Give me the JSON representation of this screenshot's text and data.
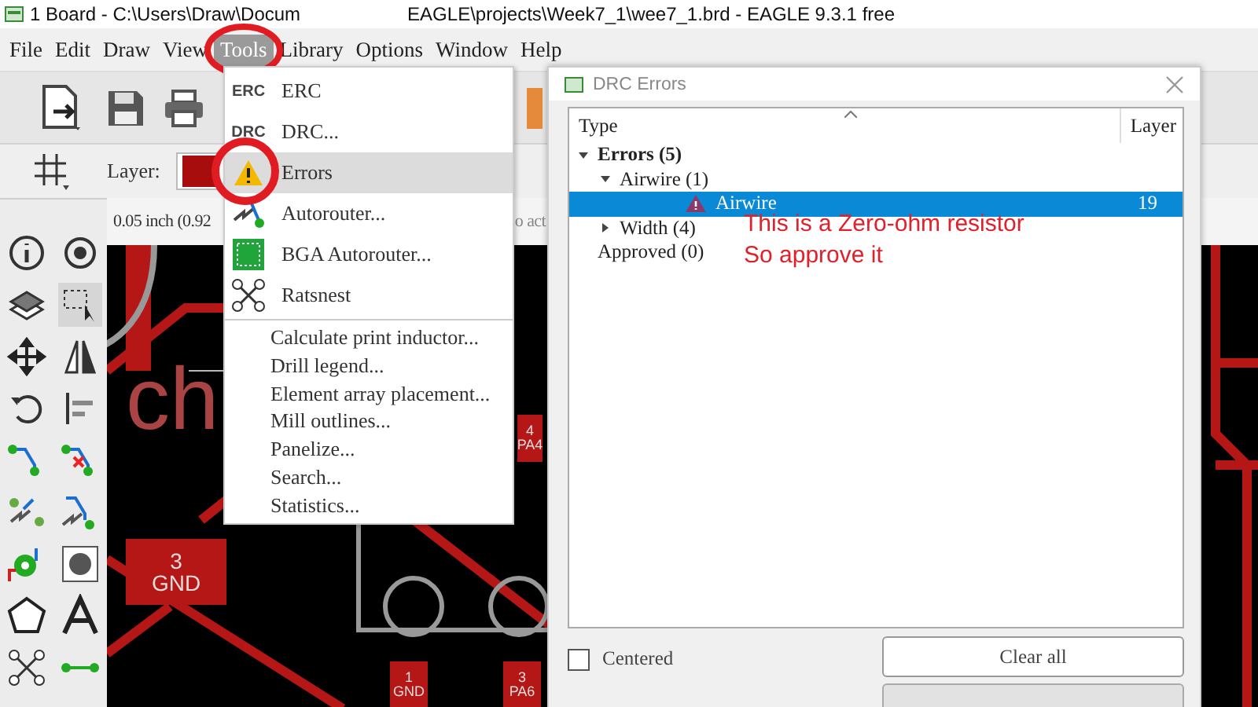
{
  "window": {
    "title_start": "1 Board - C:\\Users\\Draw\\Docum",
    "title_end": "EAGLE\\projects\\Week7_1\\wee7_1.brd - EAGLE 9.3.1 free"
  },
  "menu_bar": [
    {
      "label": "File",
      "selected": false
    },
    {
      "label": "Edit",
      "selected": false
    },
    {
      "label": "Draw",
      "selected": false
    },
    {
      "label": "View",
      "selected": false
    },
    {
      "label": "Tools",
      "selected": true
    },
    {
      "label": "Library",
      "selected": false
    },
    {
      "label": "Options",
      "selected": false
    },
    {
      "label": "Window",
      "selected": false
    },
    {
      "label": "Help",
      "selected": false
    }
  ],
  "layer_bar": {
    "label": "Layer:",
    "color": "#a80d0d"
  },
  "status": {
    "coordinates": "0.05 inch (0.92",
    "message_fragment": "o act"
  },
  "tools_menu": {
    "items": [
      {
        "kind": "erc",
        "icon_label": "ERC",
        "label": "ERC",
        "selected": false
      },
      {
        "kind": "drc",
        "icon_label": "DRC",
        "label": "DRC...",
        "selected": false
      },
      {
        "kind": "warning",
        "label": "Errors",
        "selected": true
      },
      {
        "kind": "autorouter",
        "label": "Autorouter...",
        "selected": false
      },
      {
        "kind": "bga",
        "label": "BGA Autorouter...",
        "selected": false
      },
      {
        "kind": "ratsnest",
        "label": "Ratsnest",
        "selected": false
      },
      {
        "kind": "separator"
      },
      {
        "kind": "plain",
        "label": "Calculate print inductor...",
        "selected": false
      },
      {
        "kind": "plain",
        "label": "Drill legend...",
        "selected": false
      },
      {
        "kind": "plain",
        "label": "Element array placement...",
        "selected": false
      },
      {
        "kind": "plain",
        "label": "Mill outlines...",
        "selected": false
      },
      {
        "kind": "plain",
        "label": "Panelize...",
        "selected": false
      },
      {
        "kind": "plain",
        "label": "Search...",
        "selected": false
      },
      {
        "kind": "plain",
        "label": "Statistics...",
        "selected": false
      }
    ]
  },
  "pcb": {
    "silkscreen_text": "ch",
    "pads": [
      {
        "number": "3",
        "net": "GND"
      },
      {
        "number": "4",
        "net": "PA4"
      },
      {
        "number": "1",
        "net": "GND"
      },
      {
        "number": "3",
        "net": "PA6"
      }
    ]
  },
  "drc_dialog": {
    "title": "DRC Errors",
    "columns": [
      "Type",
      "Layer"
    ],
    "tree": [
      {
        "label": "Errors (5)",
        "expanded": true,
        "selected": false,
        "children": [
          {
            "label": "Airwire (1)",
            "expanded": true,
            "selected": false,
            "children": [
              {
                "label": "Airwire",
                "layer": "19",
                "kind": "error",
                "selected": true
              }
            ]
          },
          {
            "label": "Width (4)",
            "expanded": false,
            "selected": false
          }
        ]
      },
      {
        "label": "Approved (0)",
        "selected": false
      }
    ],
    "centered": {
      "label": "Centered",
      "checked": false
    },
    "buttons": [
      "Clear all"
    ]
  },
  "annotation": {
    "lines": [
      "This is a Zero-ohm resistor",
      "So approve it"
    ]
  }
}
